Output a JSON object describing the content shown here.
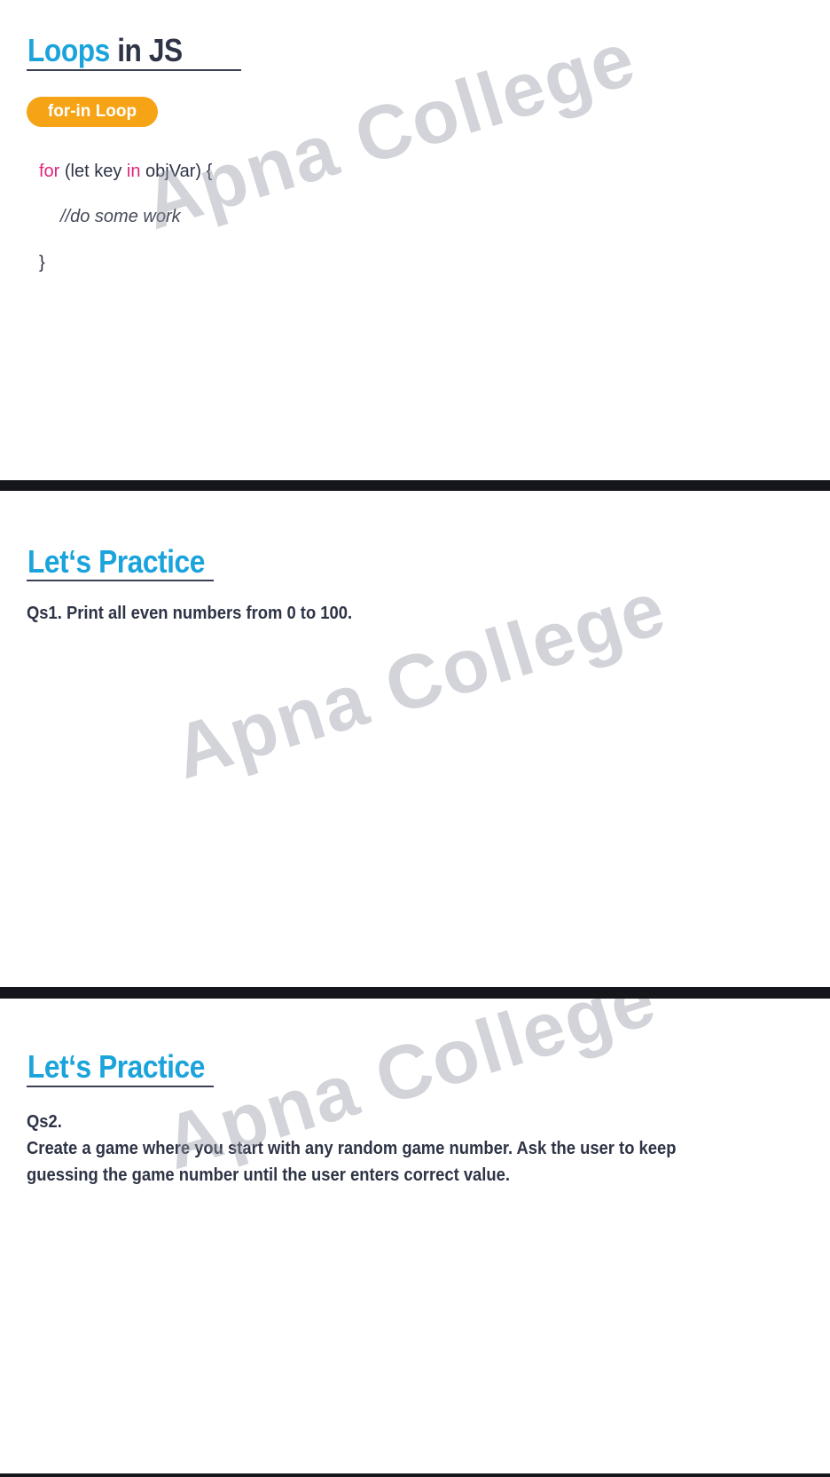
{
  "slide1": {
    "title_part1": "Loops",
    "title_part2": " in JS",
    "badge": "for-in Loop",
    "code": {
      "kw_for": "for",
      "line1_a": " (let key ",
      "kw_in": "in",
      "line1_b": " objVar) {",
      "line2": "//do some work",
      "line3": "}"
    }
  },
  "slide2": {
    "title": "Let‘s Practice",
    "question": "Qs1. Print all even numbers from 0 to 100."
  },
  "slide3": {
    "title": "Let‘s Practice",
    "question_label": "Qs2.",
    "question_line1": "Create a game where you start with any random game number. Ask the user to keep",
    "question_line2": "guessing the game number until the user enters correct value."
  },
  "watermark": "Apna College",
  "colors": {
    "accent_blue": "#1ba3db",
    "heading_dark": "#2e3446",
    "badge_orange": "#f6a316",
    "keyword_pink": "#e0247c",
    "divider": "#15161c"
  }
}
